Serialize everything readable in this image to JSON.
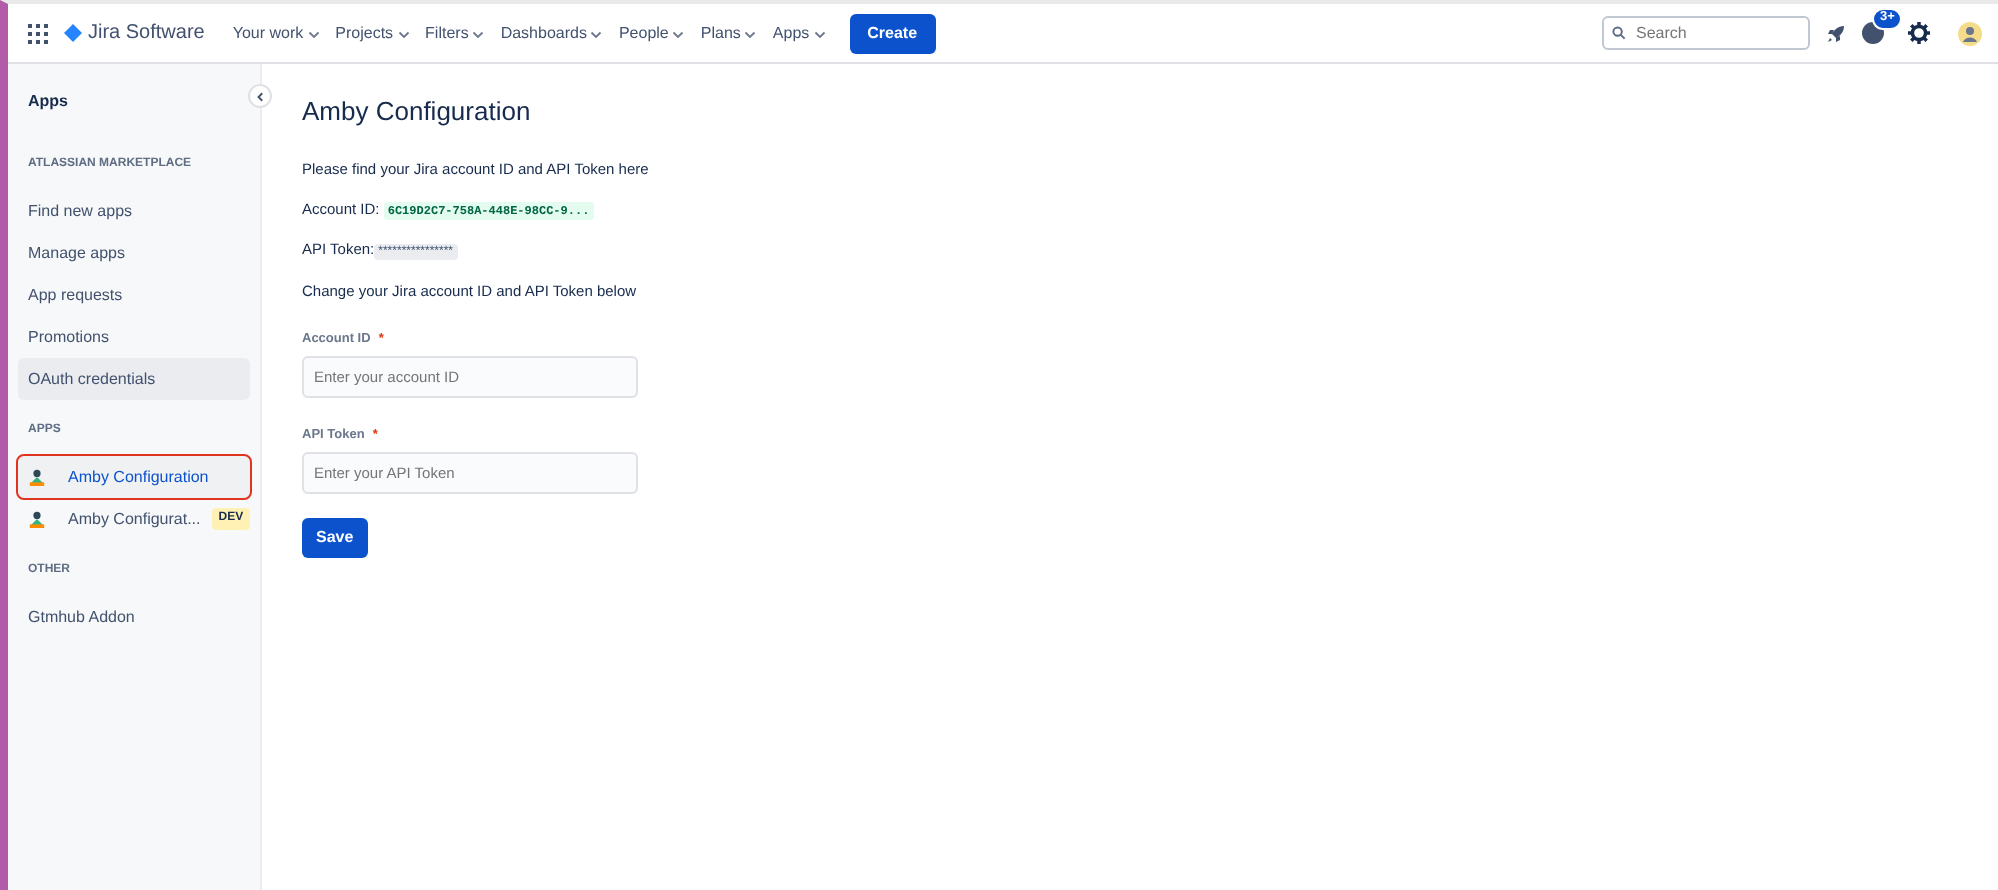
{
  "topbar": {
    "product": "Jira Software",
    "menus": [
      {
        "label": "Your work"
      },
      {
        "label": "Projects"
      },
      {
        "label": "Filters"
      },
      {
        "label": "Dashboards"
      },
      {
        "label": "People"
      },
      {
        "label": "Plans"
      },
      {
        "label": "Apps"
      }
    ],
    "create": "Create",
    "search": {
      "placeholder": "Search"
    },
    "help_badge": "3+"
  },
  "sidebar": {
    "title": "Apps",
    "sections": [
      {
        "heading": "ATLASSIAN MARKETPLACE",
        "items": [
          {
            "label": "Find new apps",
            "selected": false,
            "highlighted": false
          },
          {
            "label": "Manage apps",
            "selected": false,
            "highlighted": false
          },
          {
            "label": "App requests",
            "selected": false,
            "highlighted": false
          },
          {
            "label": "Promotions",
            "selected": false,
            "highlighted": false
          },
          {
            "label": "OAuth credentials",
            "selected": false,
            "highlighted": true
          }
        ]
      },
      {
        "heading": "APPS",
        "items": [
          {
            "label": "Amby Configuration",
            "selected": true,
            "highlighted": false,
            "outlined": true,
            "app_icon": true
          },
          {
            "label": "Amby Configurat...",
            "selected": false,
            "highlighted": false,
            "app_icon": true,
            "tag": "DEV"
          }
        ]
      },
      {
        "heading": "OTHER",
        "items": [
          {
            "label": "Gtmhub Addon",
            "selected": false,
            "highlighted": false
          }
        ]
      }
    ]
  },
  "main": {
    "title": "Amby Configuration",
    "intro": "Please find your Jira account ID and API Token here",
    "account_id": {
      "label": "Account ID:",
      "value": "6C19D2C7-758A-448E-98CC-9..."
    },
    "api_token": {
      "label": "API Token:",
      "value": "****************"
    },
    "change_text": "Change your Jira account ID and API Token below",
    "fields": [
      {
        "label": "Account ID",
        "required": "*",
        "placeholder": "Enter your account ID"
      },
      {
        "label": "API Token",
        "required": "*",
        "placeholder": "Enter your API Token"
      }
    ],
    "save": "Save"
  }
}
